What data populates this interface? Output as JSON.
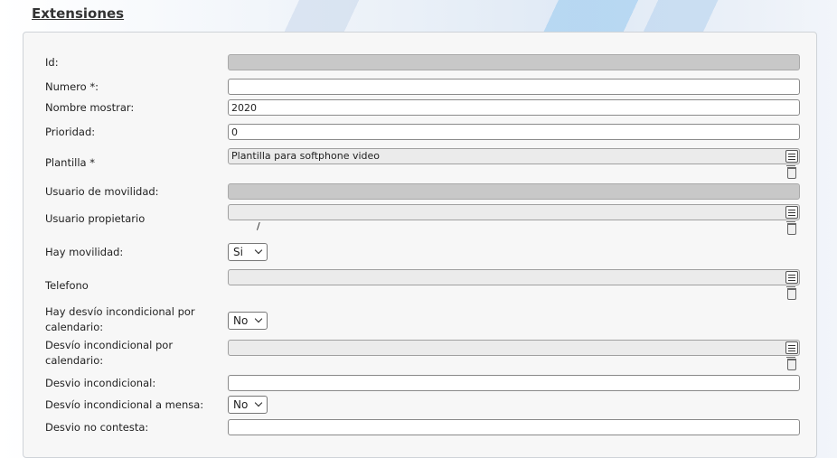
{
  "page": {
    "title": "Extensiones"
  },
  "form": {
    "id": {
      "label": "Id:",
      "value": ""
    },
    "numero": {
      "label": "Numero *:",
      "value": ""
    },
    "nombre_mostrar": {
      "label": "Nombre mostrar:",
      "value": "2020"
    },
    "prioridad": {
      "label": "Prioridad:",
      "value": "0"
    },
    "plantilla": {
      "label": "Plantilla *",
      "value": "Plantilla para softphone video"
    },
    "usuario_movilidad": {
      "label": "Usuario de movilidad:",
      "value": ""
    },
    "usuario_propietario": {
      "label": "Usuario propietario",
      "value": "  /"
    },
    "hay_movilidad": {
      "label": "Hay movilidad:",
      "value": "Si"
    },
    "telefono": {
      "label": "Telefono",
      "value": ""
    },
    "hay_desvio_calendario": {
      "label": "Hay desvío incondicional por calendario:",
      "value": "No"
    },
    "desvio_calendario": {
      "label": "Desvío incondicional por calendario:",
      "value": ""
    },
    "desvio_incondicional": {
      "label": "Desvio incondicional:",
      "value": ""
    },
    "desvio_mensa": {
      "label": "Desvío incondicional a mensa:",
      "value": "No"
    },
    "desvio_no_contesta": {
      "label": "Desvio no contesta:",
      "value": ""
    }
  },
  "icons": {
    "list": "list-icon",
    "delete": "trash-icon"
  },
  "colors": {
    "disabled_field": "#c8c8c8",
    "lookup_field": "#ebebeb",
    "panel": "#f7f7f7"
  }
}
